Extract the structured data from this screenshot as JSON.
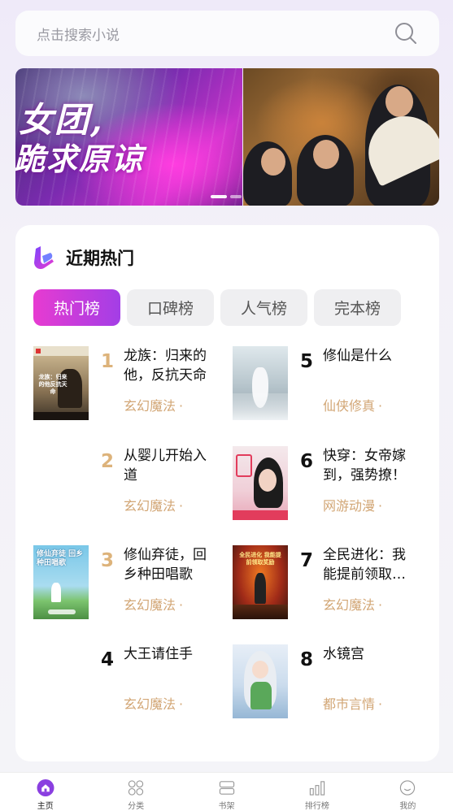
{
  "search": {
    "placeholder": "点击搜索小说",
    "icon": "search-icon"
  },
  "banner": {
    "slide1_line1": "女团,",
    "slide1_line2": "跪求原谅",
    "active_index": 1
  },
  "hot": {
    "title": "近期热门",
    "tabs": [
      {
        "label": "热门榜",
        "active": true
      },
      {
        "label": "口碑榜",
        "active": false
      },
      {
        "label": "人气榜",
        "active": false
      },
      {
        "label": "完本榜",
        "active": false
      }
    ],
    "books": [
      {
        "rank": "1",
        "title": "龙族：归来的他，反抗天命",
        "genre": "玄幻魔法",
        "has_cover": true,
        "cover_text": "龙族：归来的他反抗天命"
      },
      {
        "rank": "2",
        "title": "从婴儿开始入道",
        "genre": "玄幻魔法",
        "has_cover": false
      },
      {
        "rank": "3",
        "title": "修仙弃徒，回乡种田唱歌",
        "genre": "玄幻魔法",
        "has_cover": true,
        "cover_text": "修仙弃徒 回乡种田唱歌"
      },
      {
        "rank": "4",
        "title": "大王请住手",
        "genre": "玄幻魔法",
        "has_cover": false
      },
      {
        "rank": "5",
        "title": "修仙是什么",
        "genre": "仙侠修真",
        "has_cover": true
      },
      {
        "rank": "6",
        "title": "快穿：女帝嫁到，强势撩！",
        "genre": "网游动漫",
        "has_cover": true
      },
      {
        "rank": "7",
        "title": "全民进化：我能提前领取奖励",
        "genre": "玄幻魔法",
        "has_cover": true,
        "cover_text": "全民进化 我能提前领取奖励"
      },
      {
        "rank": "8",
        "title": "水镜宫",
        "genre": "都市言情",
        "has_cover": true
      }
    ],
    "separator": "·"
  },
  "tabbar": [
    {
      "label": "主页",
      "icon": "home-icon",
      "active": true
    },
    {
      "label": "分类",
      "icon": "category-icon",
      "active": false
    },
    {
      "label": "书架",
      "icon": "bookshelf-icon",
      "active": false
    },
    {
      "label": "排行榜",
      "icon": "ranking-icon",
      "active": false
    },
    {
      "label": "我的",
      "icon": "profile-icon",
      "active": false
    }
  ],
  "colors": {
    "accent": "#a33ee6",
    "accent_pink": "#e73bd1",
    "rank_gold": "#ddb37b",
    "genre": "#d2a675"
  }
}
